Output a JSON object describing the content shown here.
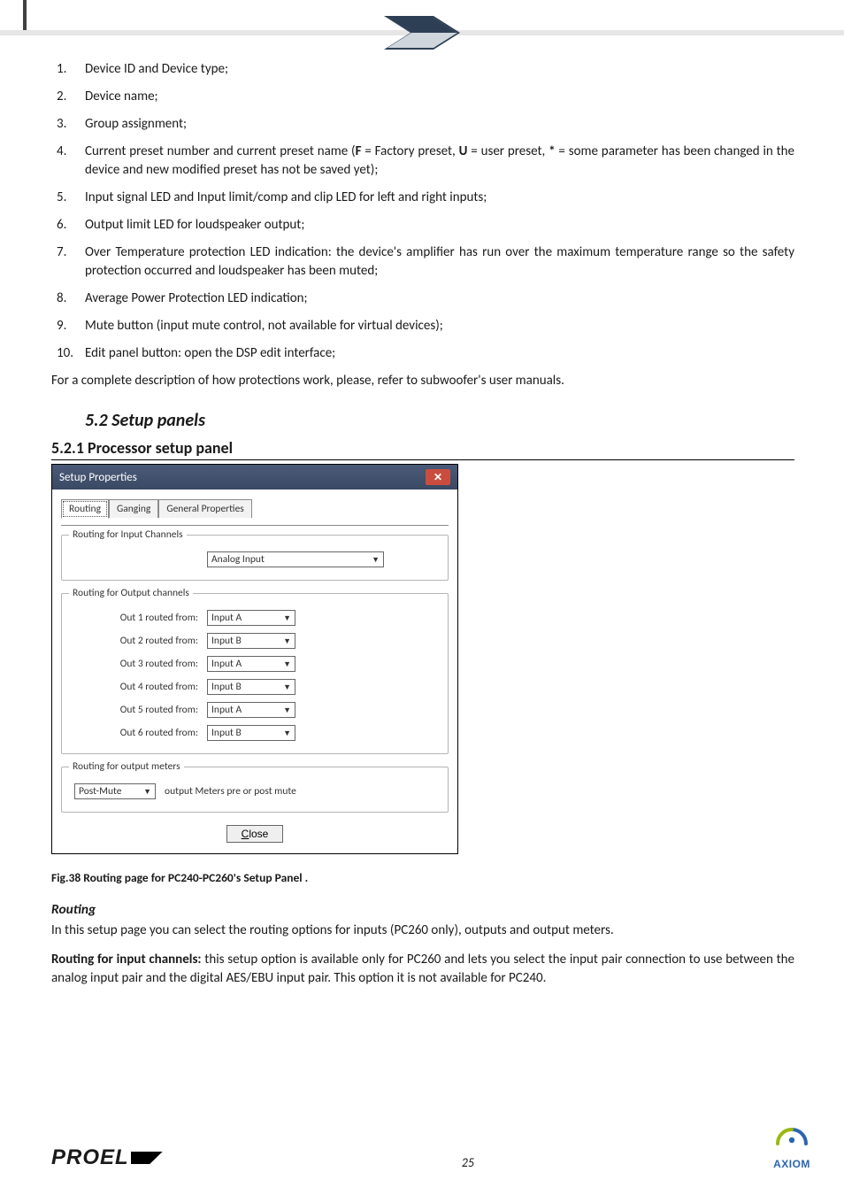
{
  "list": {
    "i1": "Device ID and Device type;",
    "i2": "Device name;",
    "i3": "Group assignment;",
    "i4_pre": "Current preset number and current preset name (",
    "i4_F": "F",
    "i4_mid1": " = Factory preset, ",
    "i4_U": "U",
    "i4_mid2": " = user preset, ",
    "i4_star": "*",
    "i4_post": " = some parameter has been changed in the device and new modified preset has not be saved yet);",
    "i5": "Input signal LED and Input limit/comp and clip LED for left and right inputs;",
    "i6": "Output limit LED for loudspeaker output;",
    "i7": "Over Temperature protection LED indication: the device's amplifier has run over the maximum temperature range so the safety protection occurred and loudspeaker has been muted;",
    "i8": "Average Power Protection LED indication;",
    "i9": "Mute button (input mute control, not available for virtual devices);",
    "i10": "Edit panel button: open the DSP edit interface;"
  },
  "para_after": "For a complete description of how protections work, please, refer to subwoofer's user manuals.",
  "h52": "5.2   Setup panels",
  "h521": "5.2.1   Processor setup panel",
  "dlg": {
    "title": "Setup Properties",
    "tabs": {
      "routing": "Routing",
      "ganging": "Ganging",
      "general": "General Properties"
    },
    "fs1": {
      "legend": "Routing for Input Channels",
      "value": "Analog Input"
    },
    "fs2": {
      "legend": "Routing for Output channels",
      "rows": {
        "r1l": "Out 1 routed from:",
        "r1v": "Input A",
        "r2l": "Out 2 routed from:",
        "r2v": "Input B",
        "r3l": "Out 3 routed from:",
        "r3v": "Input A",
        "r4l": "Out 4 routed from:",
        "r4v": "Input B",
        "r5l": "Out 5 routed from:",
        "r5v": "Input A",
        "r6l": "Out 6 routed from:",
        "r6v": "Input B"
      }
    },
    "fs3": {
      "legend": "Routing for output meters",
      "sel": "Post-Mute",
      "desc": "output Meters pre or post mute"
    },
    "close": "Close"
  },
  "caption": "Fig.38 Routing page for PC240-PC260's Setup Panel .",
  "routing_h": "Routing",
  "routing_p1": "In this setup page you can select the routing options for inputs (PC260 only), outputs and output meters.",
  "routing_p2_b": "Routing for input channels:",
  "routing_p2": " this setup option is available only for PC260 and lets you select the input pair connection to use between the analog input pair and the digital AES/EBU input pair. This option it is not available for PC240.",
  "footer": {
    "proel": "PROEL",
    "pagenum": "25",
    "axiom": "AXIOM"
  }
}
